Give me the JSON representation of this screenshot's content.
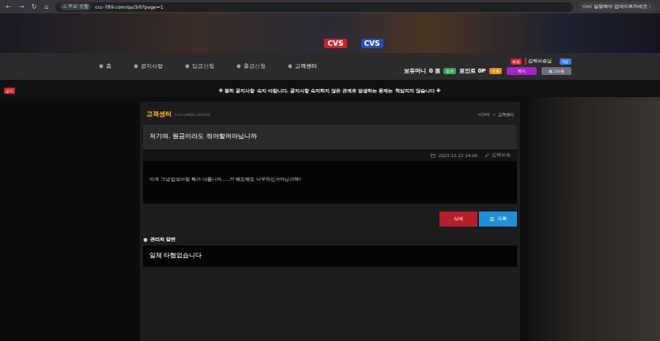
{
  "browser": {
    "nav_icons": [
      "←",
      "→",
      "↻",
      "⌂"
    ],
    "security": "주의 요함",
    "url": "ccc-789.com/qa/3/0?page=1",
    "update_button": "다시 실행해야 업데이트하세요 :"
  },
  "header": {
    "logo": "CVS"
  },
  "nav": {
    "items": [
      {
        "label": "홈",
        "selected": false
      },
      {
        "label": "공지사항",
        "selected": false
      },
      {
        "label": "입금신청",
        "selected": false
      },
      {
        "label": "출금신청",
        "selected": false
      },
      {
        "label": "고객센터",
        "selected": true
      }
    ]
  },
  "account": {
    "level_badge": "회원",
    "username": "김해퍼승님",
    "message_count": "0건",
    "money_label": "보유머니",
    "money": "0 원",
    "charge_button": "충전",
    "point_label": "포인트 0P",
    "convert_button": "전환",
    "buttons": [
      {
        "label": "쪽지",
        "color": "#a424c8"
      },
      {
        "label": "로그아웃",
        "color": "#6b6f78"
      }
    ]
  },
  "notice": {
    "badge": "공지",
    "text": "※ 필히 공지사항 숙지 바랍니다. 공지사항 숙지하지 않은 관계로 발생하는 문제는 책임지지 않습니다 ※"
  },
  "page": {
    "title": "고객센터",
    "subtitle": "CUSTOMER CENTER",
    "breadcrumb": [
      "HOME",
      ">",
      "고객센터"
    ]
  },
  "post": {
    "title": "저기여. 원금이라도 줘야할꺼아닙니까",
    "date": "2023-11-12 14:08",
    "author": "김해퍼승",
    "body": "이게 그냥 입먹이랑 뭐가 다릅니까......?? 해도해도 너무하신거아닌가여?"
  },
  "actions": [
    {
      "label": "삭제",
      "icon": "",
      "color": "#b3202a"
    },
    {
      "label": "목록",
      "icon": "☰",
      "color": "#1e8fd8"
    }
  ],
  "reply": {
    "heading": "관리자 답변",
    "body": "일체 타협없습니다"
  }
}
